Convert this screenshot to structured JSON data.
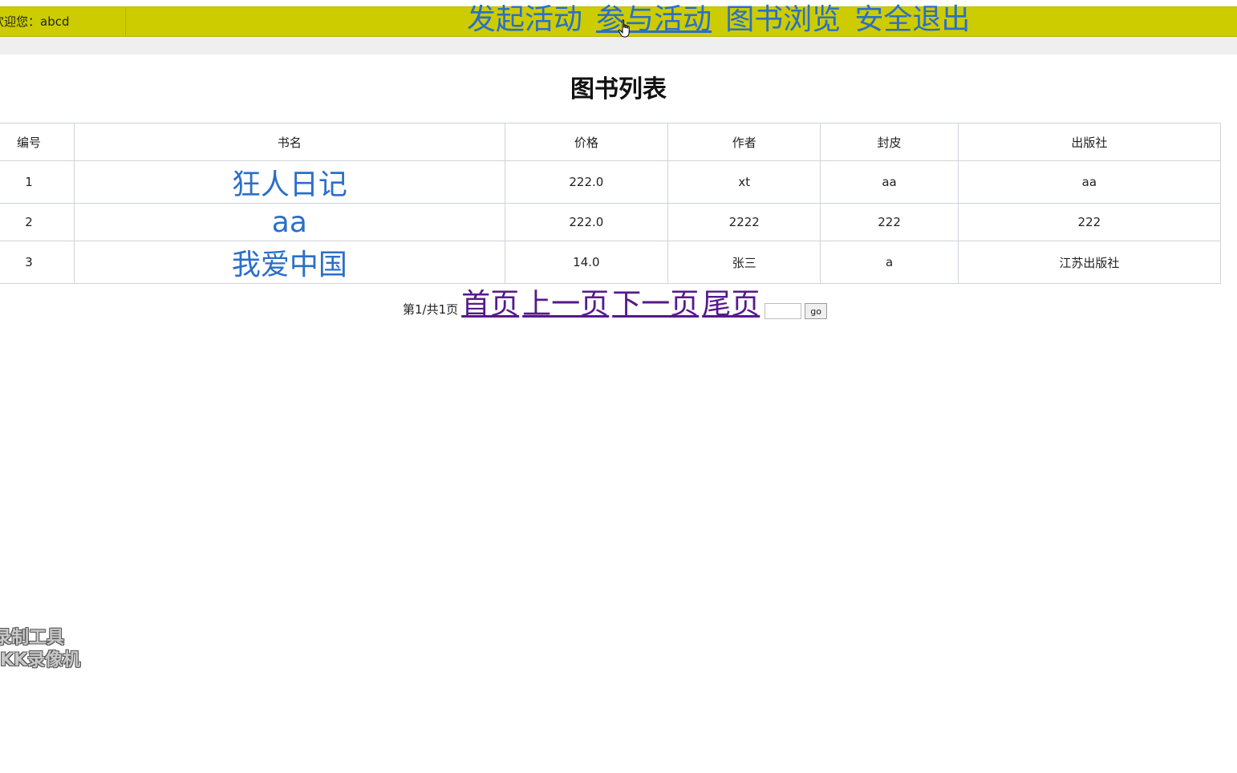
{
  "header": {
    "welcome": "欢迎您：abcd",
    "nav": [
      {
        "label": "发起活动"
      },
      {
        "label": "参与活动"
      },
      {
        "label": "图书浏览"
      },
      {
        "label": "安全退出"
      }
    ]
  },
  "main": {
    "title": "图书列表",
    "table": {
      "columns": [
        "编号",
        "书名",
        "价格",
        "作者",
        "封皮",
        "出版社"
      ],
      "rows": [
        {
          "id": "1",
          "name": "狂人日记",
          "price": "222.0",
          "author": "xt",
          "cover": "aa",
          "publisher": "aa"
        },
        {
          "id": "2",
          "name": "aa",
          "price": "222.0",
          "author": "2222",
          "cover": "222",
          "publisher": "222"
        },
        {
          "id": "3",
          "name": "我爱中国",
          "price": "14.0",
          "author": "张三",
          "cover": "a",
          "publisher": "江苏出版社"
        }
      ]
    },
    "pager": {
      "info": "第1/共1页",
      "first": "首页",
      "prev": "上一页",
      "next": "下一页",
      "last": "尾页",
      "page_input_value": "",
      "go_label": "go"
    }
  },
  "watermark": {
    "line1": "录制工具",
    "line2": "KK录像机"
  },
  "colors": {
    "topbar": "#cccc00",
    "nav_link": "#2a6fc9",
    "visited_link": "#551a8b"
  }
}
